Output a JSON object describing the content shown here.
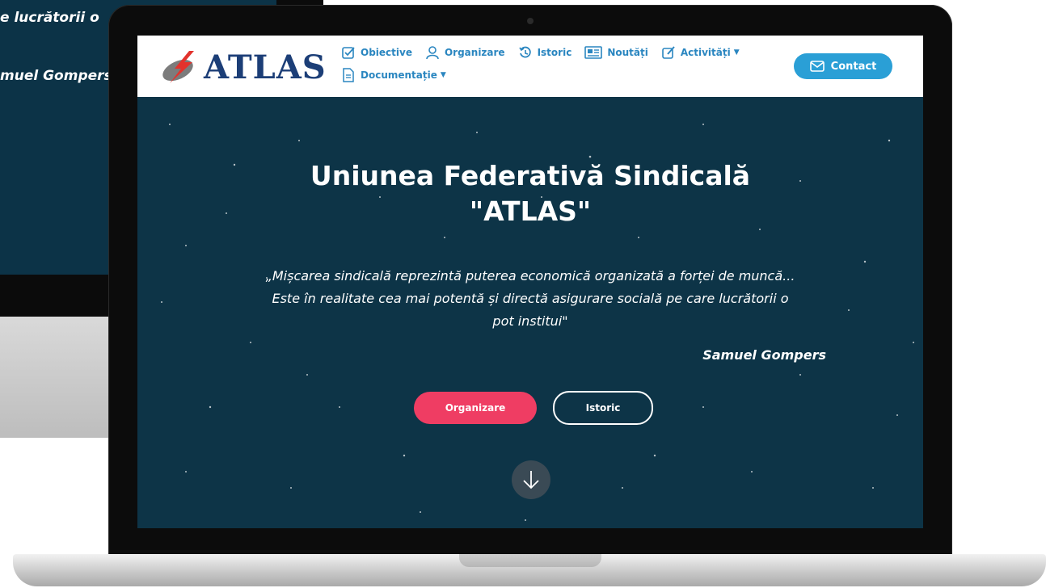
{
  "background_monitor": {
    "line1": "e lucrătorii o",
    "line2": "muel Gompers"
  },
  "header": {
    "logo_text": "ATLAS",
    "nav": [
      {
        "label": "Obiective",
        "icon": "checkbox-icon"
      },
      {
        "label": "Organizare",
        "icon": "user-icon"
      },
      {
        "label": "Istoric",
        "icon": "history-icon"
      },
      {
        "label": "Noutăți",
        "icon": "newspaper-icon"
      },
      {
        "label": "Activități",
        "icon": "edit-icon",
        "dropdown": true
      },
      {
        "label": "Documentație",
        "icon": "document-icon",
        "dropdown": true
      }
    ],
    "contact_label": "Contact"
  },
  "hero": {
    "title_line1": "Uniunea Federativă Sindicală",
    "title_line2": "\"ATLAS\"",
    "quote_line1": "„Mișcarea sindicală reprezintă puterea economică organizată a forței de muncă...",
    "quote_line2": "Este în realitate cea mai potentă și directă asigurare socială pe care lucrătorii o",
    "quote_line3": "pot institui\"",
    "author": "Samuel Gompers",
    "primary_button": "Organizare",
    "secondary_button": "Istoric"
  },
  "colors": {
    "hero_bg": "#0d3447",
    "nav_text": "#2a86c0",
    "contact_bg": "#2a9fd6",
    "primary_button": "#ef3d63",
    "logo_text": "#1c3e77"
  }
}
